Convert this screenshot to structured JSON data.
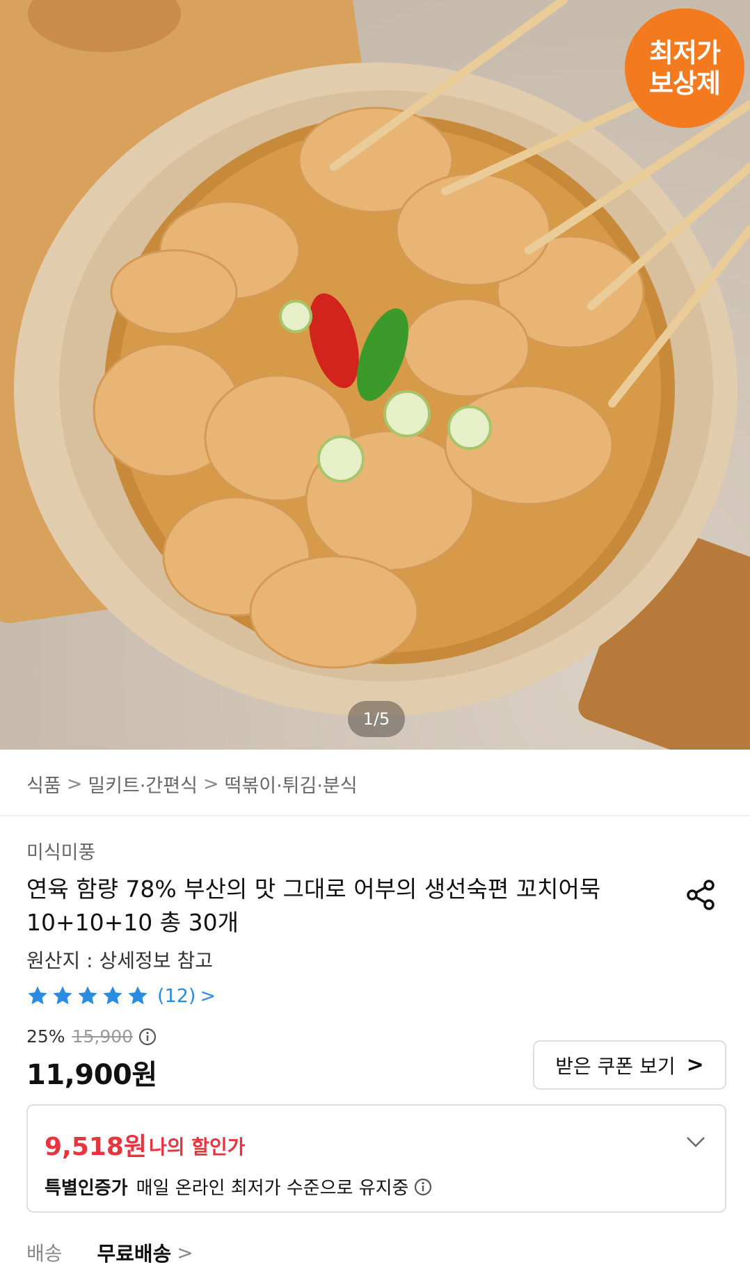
{
  "hero": {
    "badge_line1": "최저가",
    "badge_line2": "보상제",
    "pager": "1/5",
    "badge_color": "#f47a20"
  },
  "breadcrumb": {
    "items": [
      "식품",
      "밀키트·간편식",
      "떡볶이·튀김·분식"
    ],
    "separator": ">"
  },
  "product": {
    "brand": "미식미풍",
    "title": "연육 함량 78% 부산의 맛 그대로 어부의 생선숙편 꼬치어묵 10+10+10 총 30개",
    "origin": "원산지 : 상세정보 참고",
    "rating": {
      "stars": 5,
      "count": "(12)",
      "chevron": ">"
    },
    "discount_rate": "25%",
    "original_price": "15,900",
    "price": "11,900원",
    "coupon_button": "받은 쿠폰 보기",
    "coupon_chevron": ">"
  },
  "my_discount": {
    "price": "9,518원",
    "label": "나의 할인가",
    "cert_badge": "특별인증가",
    "cert_text": "매일 온라인 최저가 수준으로 유지중",
    "accent_color": "#e8343f"
  },
  "shipping": {
    "label": "배송",
    "value": "무료배송",
    "chevron": ">"
  },
  "colors": {
    "star": "#2a8be3",
    "link": "#2a8be3"
  }
}
